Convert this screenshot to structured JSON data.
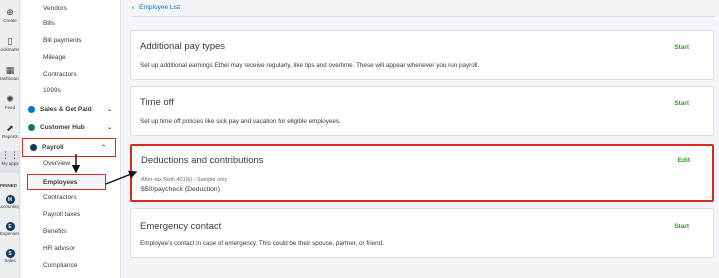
{
  "rail": {
    "items": [
      {
        "icon": "⊕",
        "label": "Create"
      },
      {
        "icon": "▯",
        "label": "Bookmarks"
      },
      {
        "icon": "▦",
        "label": "Dashboard"
      },
      {
        "icon": "✺",
        "label": "Feed"
      },
      {
        "icon": "⬈",
        "label": "Reports"
      },
      {
        "icon": "⋮⋮",
        "label": "My apps"
      }
    ],
    "pinned_label": "PINNED",
    "apps": [
      {
        "letter": "M",
        "label": "Accounting",
        "color": "#0b3b5b"
      },
      {
        "letter": "E",
        "label": "Expenses",
        "color": "#0b3b5b"
      },
      {
        "letter": "S",
        "label": "Sales",
        "color": "#0b3b5b"
      }
    ]
  },
  "sidebar": {
    "vendors": "Vendors",
    "bills": "Bills",
    "bill_payments": "Bill payments",
    "mileage": "Mileage",
    "contractors_top": "Contractors",
    "forms_1099": "1099s",
    "sales_get_paid": "Sales & Get Paid",
    "customer_hub": "Customer Hub",
    "payroll": "Payroll",
    "overview": "Overview",
    "employees": "Employees",
    "contractors": "Contractors",
    "payroll_taxes": "Payroll taxes",
    "benefits": "Benefits",
    "hr_advisor": "HR advisor",
    "compliance": "Compliance"
  },
  "main": {
    "back_link": "Employee List",
    "cards": {
      "additional_pay": {
        "title": "Additional pay types",
        "desc": "Set up additional earnings Ethel may receive regularly, like tips and overtime. These will appear whenever you run payroll.",
        "action": "Start"
      },
      "time_off": {
        "title": "Time off",
        "desc": "Set up time off policies like sick pay and vacation for eligible employees.",
        "action": "Start"
      },
      "deductions": {
        "title": "Deductions and contributions",
        "detail": "After-tax Roth 401(k) - Sample only",
        "amount": "$50/paycheck (Deduction)",
        "action": "Edit"
      },
      "emergency": {
        "title": "Emergency contact",
        "desc": "Employee's contact in case of emergency. This could be their spouse, partner, or friend.",
        "action": "Start"
      }
    }
  },
  "colors": {
    "accent_green": "#2ca01c",
    "link_blue": "#0077c5",
    "highlight_red": "#d52b1e"
  }
}
